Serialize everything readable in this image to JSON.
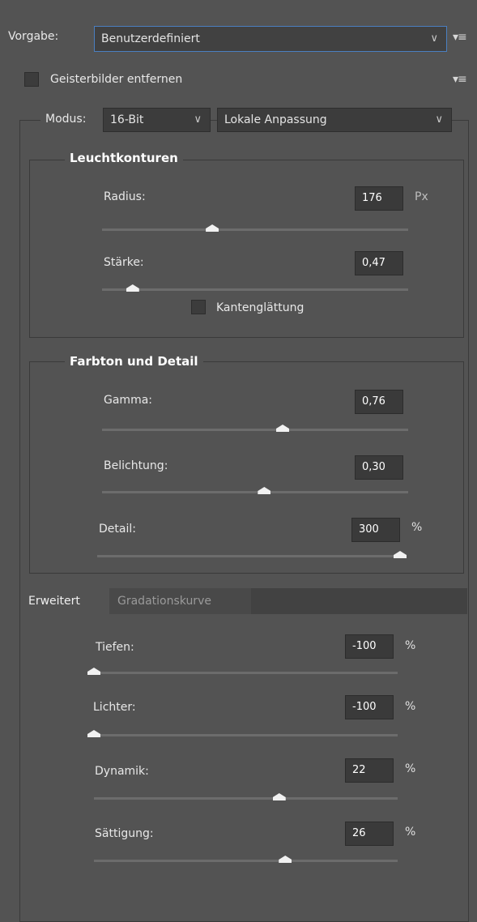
{
  "preset": {
    "label": "Vorgabe:",
    "value": "Benutzerdefiniert"
  },
  "ghost": {
    "label": "Geisterbilder entfernen",
    "checked": false
  },
  "mode": {
    "label": "Modus:",
    "bit_depth": "16-Bit",
    "method": "Lokale Anpassung"
  },
  "edge_glow": {
    "title": "Leuchtkonturen",
    "radius": {
      "label": "Radius:",
      "value": "176",
      "unit": "Px",
      "fraction": 0.36
    },
    "strength": {
      "label": "Stärke:",
      "value": "0,47",
      "fraction": 0.1
    },
    "smooth_edges": {
      "label": "Kantenglättung",
      "checked": false
    }
  },
  "tone_detail": {
    "title": "Farbton und Detail",
    "gamma": {
      "label": "Gamma:",
      "value": "0,76",
      "fraction": 0.59
    },
    "exposure": {
      "label": "Belichtung:",
      "value": "0,30",
      "fraction": 0.53
    },
    "detail": {
      "label": "Detail:",
      "value": "300",
      "unit": "%",
      "fraction": 1.0
    }
  },
  "tabs": [
    "Erweitert",
    "Gradationskurve"
  ],
  "advanced": {
    "shadows": {
      "label": "Tiefen:",
      "value": "-100",
      "unit": "%",
      "fraction": 0.0
    },
    "highlights": {
      "label": "Lichter:",
      "value": "-100",
      "unit": "%",
      "fraction": 0.0
    },
    "vibrance": {
      "label": "Dynamik:",
      "value": "22",
      "unit": "%",
      "fraction": 0.61
    },
    "saturation": {
      "label": "Sättigung:",
      "value": "26",
      "unit": "%",
      "fraction": 0.63
    }
  },
  "icons": {
    "dropdown": "chevron-down-icon",
    "menu": "panel-menu-icon"
  }
}
